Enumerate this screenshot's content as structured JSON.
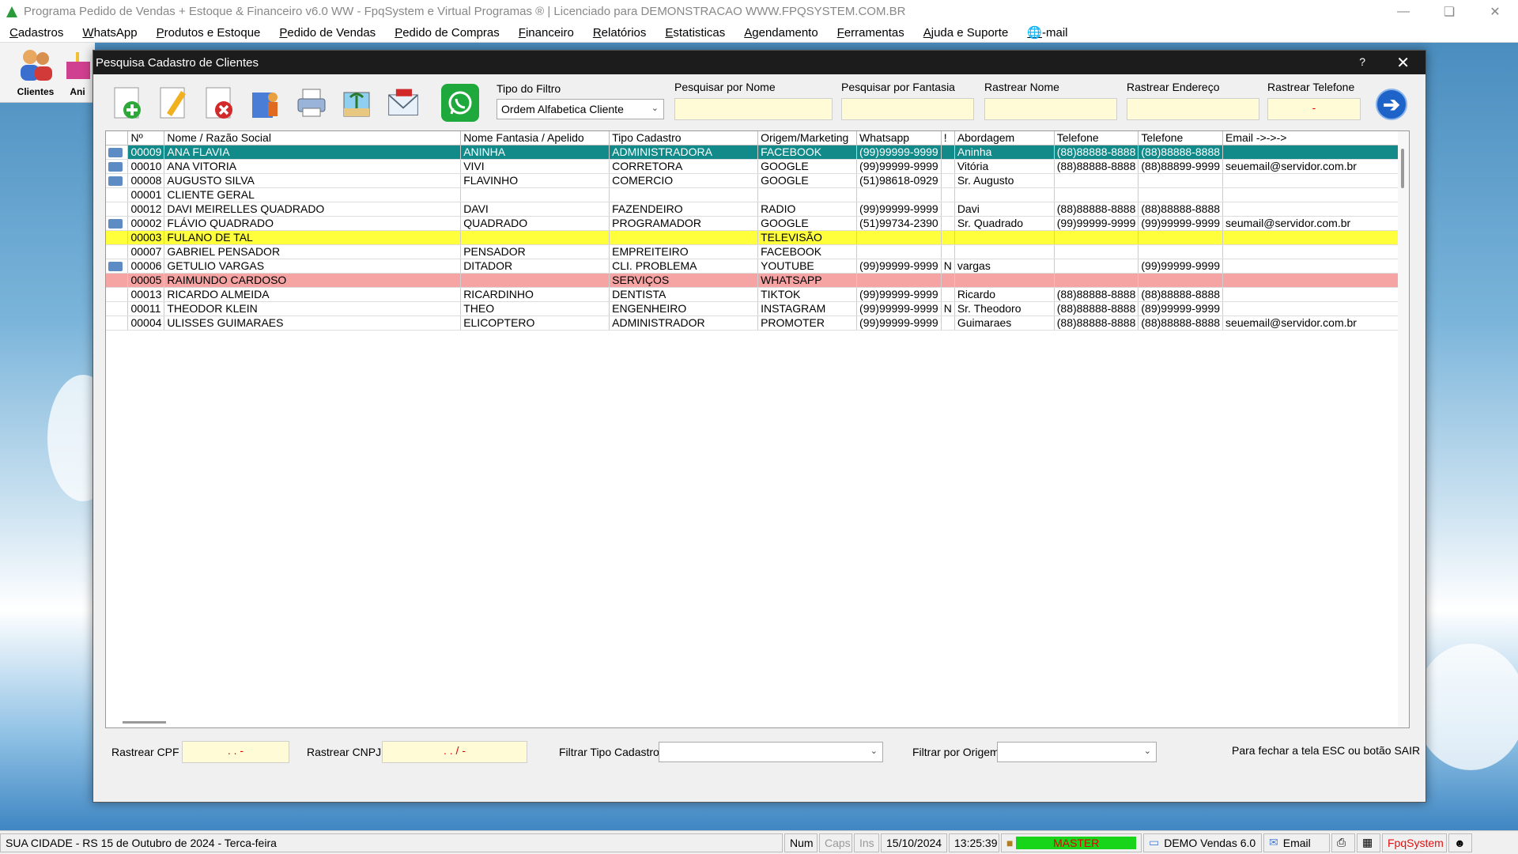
{
  "app": {
    "title": "Programa Pedido de Vendas + Estoque & Financeiro v6.0 WW - FpqSystem e Virtual Programas ® | Licenciado para  DEMONSTRACAO WWW.FPQSYSTEM.COM.BR",
    "menu": [
      "Cadastros",
      "WhatsApp",
      "Produtos e Estoque",
      "Pedido de Vendas",
      "Pedido de Compras",
      "Financeiro",
      "Relatórios",
      "Estatisticas",
      "Agendamento",
      "Ferramentas",
      "Ajuda e Suporte",
      "-mail"
    ],
    "toolbar": {
      "clientes": "Clientes",
      "aniv": "Ani"
    }
  },
  "dialog": {
    "title": "Pesquisa Cadastro de Clientes",
    "help": "?",
    "filter_type_label": "Tipo do Filtro",
    "filter_type_value": "Ordem Alfabetica Cliente",
    "search_name_label": "Pesquisar por Nome",
    "search_fantasia_label": "Pesquisar por Fantasia",
    "track_name_label": "Rastrear Nome",
    "track_address_label": "Rastrear Endereço",
    "track_phone_label": "Rastrear Telefone",
    "track_phone_value": "-",
    "columns": [
      "Nº",
      "Nome / Razão Social",
      "Nome Fantasia / Apelido",
      "Tipo Cadastro",
      "Origem/Marketing",
      "Whatsapp",
      "!",
      "Abordagem",
      "Telefone",
      "Telefone",
      "Email ->->->"
    ],
    "rows": [
      {
        "icon": true,
        "style": "sel",
        "cells": [
          "00009",
          "ANA FLAVIA",
          "ANINHA",
          "ADMINISTRADORA",
          "FACEBOOK",
          "(99)99999-9999",
          "",
          "Aninha",
          "(88)88888-8888",
          "(88)88888-8888",
          ""
        ]
      },
      {
        "icon": true,
        "style": "",
        "cells": [
          "00010",
          "ANA VITORIA",
          "VIVI",
          "CORRETORA",
          "GOOGLE",
          "(99)99999-9999",
          "",
          "Vitória",
          "(88)88888-8888",
          "(88)88899-9999",
          "seuemail@servidor.com.br"
        ]
      },
      {
        "icon": true,
        "style": "",
        "cells": [
          "00008",
          "AUGUSTO SILVA",
          "FLAVINHO",
          "COMERCIO",
          "GOOGLE",
          "(51)98618-0929",
          "",
          "Sr. Augusto",
          "",
          "",
          ""
        ]
      },
      {
        "icon": false,
        "style": "",
        "cells": [
          "00001",
          "CLIENTE GERAL",
          "",
          "",
          "",
          "",
          "",
          "",
          "",
          "",
          ""
        ]
      },
      {
        "icon": false,
        "style": "",
        "cells": [
          "00012",
          "DAVI MEIRELLES QUADRADO",
          "DAVI",
          "FAZENDEIRO",
          "RADIO",
          "(99)99999-9999",
          "",
          "Davi",
          "(88)88888-8888",
          "(88)88888-8888",
          ""
        ]
      },
      {
        "icon": true,
        "style": "",
        "cells": [
          "00002",
          "FLÁVIO QUADRADO",
          "QUADRADO",
          "PROGRAMADOR",
          "GOOGLE",
          "(51)99734-2390",
          "",
          "Sr. Quadrado",
          "(99)99999-9999",
          "(99)99999-9999",
          "seumail@servidor.com.br"
        ]
      },
      {
        "icon": false,
        "style": "yellow",
        "cells": [
          "00003",
          "FULANO DE TAL",
          "",
          "",
          "TELEVISÃO",
          "",
          "",
          "",
          "",
          "",
          ""
        ]
      },
      {
        "icon": false,
        "style": "",
        "cells": [
          "00007",
          "GABRIEL PENSADOR",
          "PENSADOR",
          "EMPREITEIRO",
          "FACEBOOK",
          "",
          "",
          "",
          "",
          "",
          ""
        ]
      },
      {
        "icon": true,
        "style": "",
        "cells": [
          "00006",
          "GETULIO VARGAS",
          "DITADOR",
          "CLI. PROBLEMA",
          "YOUTUBE",
          "(99)99999-9999",
          "N",
          "vargas",
          "",
          "(99)99999-9999",
          ""
        ]
      },
      {
        "icon": false,
        "style": "red",
        "cells": [
          "00005",
          "RAIMUNDO CARDOSO",
          "",
          "SERVIÇOS",
          "WHATSAPP",
          "",
          "",
          "",
          "",
          "",
          ""
        ]
      },
      {
        "icon": false,
        "style": "",
        "cells": [
          "00013",
          "RICARDO ALMEIDA",
          "RICARDINHO",
          "DENTISTA",
          "TIKTOK",
          "(99)99999-9999",
          "",
          "Ricardo",
          "(88)88888-8888",
          "(88)88888-8888",
          ""
        ]
      },
      {
        "icon": false,
        "style": "",
        "cells": [
          "00011",
          "THEODOR KLEIN",
          "THEO",
          "ENGENHEIRO",
          "INSTAGRAM",
          "(99)99999-9999",
          "N",
          "Sr. Theodoro",
          "(88)88888-8888",
          "(89)99999-9999",
          ""
        ]
      },
      {
        "icon": false,
        "style": "",
        "cells": [
          "00004",
          "ULISSES GUIMARAES",
          "ELICOPTERO",
          "ADMINISTRADOR",
          "PROMOTER",
          "(99)99999-9999",
          "",
          "Guimaraes",
          "(88)88888-8888",
          "(88)88888-8888",
          "seuemail@servidor.com.br"
        ]
      }
    ],
    "cpf_label": "Rastrear CPF",
    "cpf_value": ".  .  -",
    "cnpj_label": "Rastrear CNPJ",
    "cnpj_value": ".  .  /  -",
    "filter_tipo_label": "Filtrar Tipo Cadastro",
    "filter_origem_label": "Filtrar por Origem",
    "close_hint": "Para fechar a tela ESC ou botão SAIR"
  },
  "statusbar": {
    "location": "SUA CIDADE - RS 15 de Outubro de 2024 - Terca-feira",
    "num": "Num",
    "caps": "Caps",
    "ins": "Ins",
    "date": "15/10/2024",
    "time": "13:25:39",
    "user": "MASTER",
    "version": "DEMO Vendas 6.0",
    "email": "Email",
    "brand": "FpqSystem"
  },
  "colors": {
    "selected": "#138a8a",
    "yellow": "#ffff3c",
    "red": "#f5a3a3",
    "master": "#19d519",
    "brand": "#e01010"
  }
}
